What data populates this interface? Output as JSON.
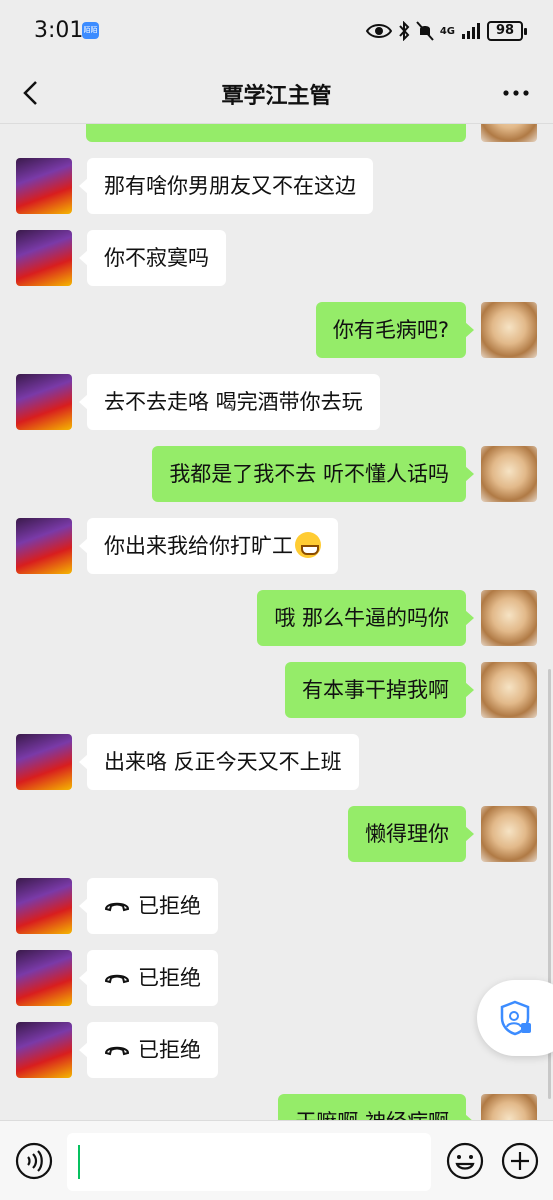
{
  "status_bar": {
    "time": "3:01",
    "app_badge": "陌陌",
    "network": "4G",
    "battery": "98"
  },
  "header": {
    "title": "覃学江主管"
  },
  "messages": [
    {
      "side": "right",
      "text": "",
      "partial": "top"
    },
    {
      "side": "left",
      "text": "那有啥你男朋友又不在这边"
    },
    {
      "side": "left",
      "text": "你不寂寞吗"
    },
    {
      "side": "right",
      "text": "你有毛病吧?"
    },
    {
      "side": "left",
      "text": "去不去走咯 喝完酒带你去玩"
    },
    {
      "side": "right",
      "text": "我都是了我不去 听不懂人话吗"
    },
    {
      "side": "left",
      "text": "你出来我给你打旷工",
      "emoji": "grinning-face-emoji"
    },
    {
      "side": "right",
      "text": "哦 那么牛逼的吗你"
    },
    {
      "side": "right",
      "text": "有本事干掉我啊"
    },
    {
      "side": "left",
      "text": "出来咯 反正今天又不上班"
    },
    {
      "side": "right",
      "text": "懒得理你"
    },
    {
      "side": "left",
      "text": "已拒绝",
      "icon": "call-declined-icon"
    },
    {
      "side": "left",
      "text": "已拒绝",
      "icon": "call-declined-icon"
    },
    {
      "side": "left",
      "text": "已拒绝",
      "icon": "call-declined-icon"
    },
    {
      "side": "right",
      "text": "干嘛啊 神经病啊",
      "partial": "bottom"
    }
  ],
  "input": {
    "value": "",
    "placeholder": ""
  },
  "colors": {
    "background": "#ededed",
    "sent_bubble": "#95ec69",
    "received_bubble": "#ffffff",
    "caret": "#07c160",
    "accent": "#3c8cff"
  }
}
